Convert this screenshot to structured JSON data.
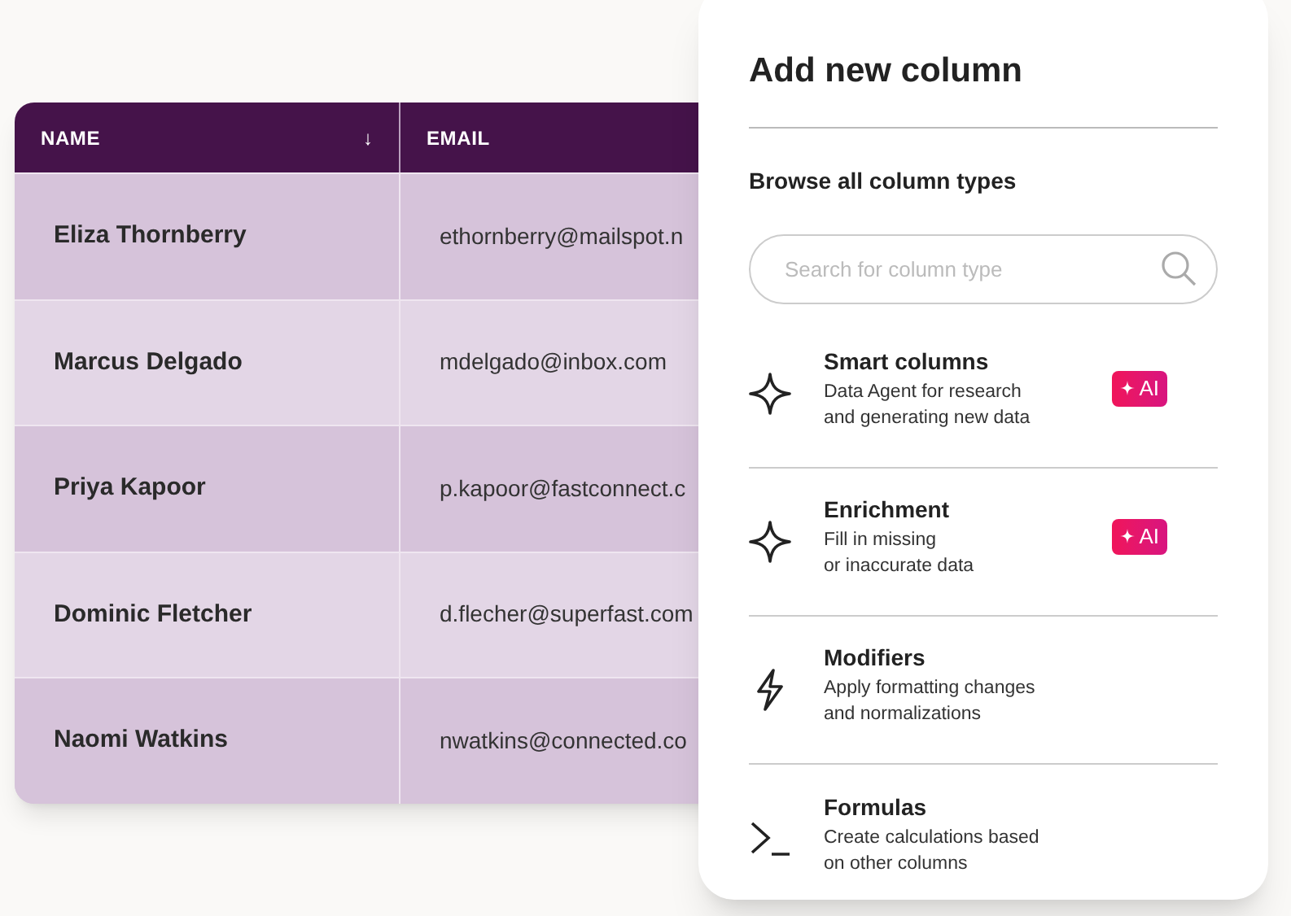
{
  "table": {
    "columns": [
      {
        "label": "NAME",
        "sort_indicator": "↓"
      },
      {
        "label": "EMAIL"
      }
    ],
    "rows": [
      {
        "name": "Eliza Thornberry",
        "email": "ethornberry@mailspot.n"
      },
      {
        "name": "Marcus Delgado",
        "email": "mdelgado@inbox.com"
      },
      {
        "name": "Priya Kapoor",
        "email": "p.kapoor@fastconnect.c"
      },
      {
        "name": "Dominic Fletcher",
        "email": "d.flecher@superfast.com"
      },
      {
        "name": "Naomi Watkins",
        "email": "nwatkins@connected.co"
      }
    ]
  },
  "panel": {
    "title": "Add new column",
    "subtitle": "Browse all column types",
    "search": {
      "placeholder": "Search for column type"
    },
    "column_types": [
      {
        "kind": "sparkle",
        "title": "Smart columns",
        "description": "Data Agent for research\nand generating new data",
        "badge": "AI"
      },
      {
        "kind": "sparkle",
        "title": "Enrichment",
        "description": "Fill in missing\nor inaccurate data",
        "badge": "AI"
      },
      {
        "kind": "bolt",
        "title": "Modifiers",
        "description": "Apply formatting changes\nand normalizations"
      },
      {
        "kind": "prompt",
        "title": "Formulas",
        "description": "Create calculations based\non other columns"
      }
    ]
  }
}
